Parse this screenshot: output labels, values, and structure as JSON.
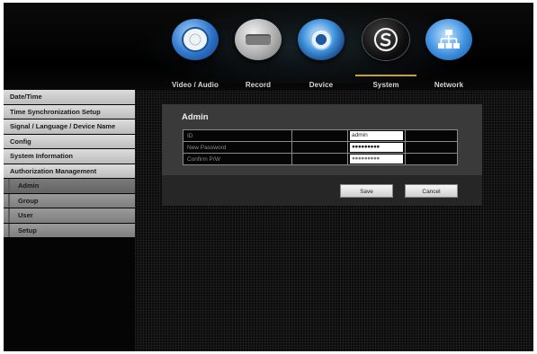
{
  "nav": {
    "tabs": [
      {
        "label": "Video / Audio",
        "icon": "video-reel-icon"
      },
      {
        "label": "Record",
        "icon": "hard-drive-icon"
      },
      {
        "label": "Device",
        "icon": "device-gear-icon"
      },
      {
        "label": "System",
        "icon": "system-s-icon",
        "selected": true
      },
      {
        "label": "Network",
        "icon": "network-icon"
      }
    ],
    "accent_color": "#c8a227"
  },
  "sidebar": {
    "items": [
      {
        "label": "Date/Time"
      },
      {
        "label": "Time Synchronization Setup"
      },
      {
        "label": "Signal / Language / Device Name"
      },
      {
        "label": "Config"
      },
      {
        "label": "System Information"
      },
      {
        "label": "Authorization Management"
      }
    ],
    "subitems": [
      {
        "label": "Admin",
        "selected": true
      },
      {
        "label": "Group"
      },
      {
        "label": "User"
      },
      {
        "label": "Setup"
      }
    ]
  },
  "panel": {
    "title": "Admin",
    "fields": [
      {
        "label": "ID",
        "value": "admin"
      },
      {
        "label": "New Password",
        "value": "●●●●●●●●●"
      },
      {
        "label": "Confirm P/W",
        "value": "●●●●●●●●●"
      }
    ]
  },
  "buttons": {
    "save_label": "Save",
    "cancel_label": "Cancel"
  }
}
